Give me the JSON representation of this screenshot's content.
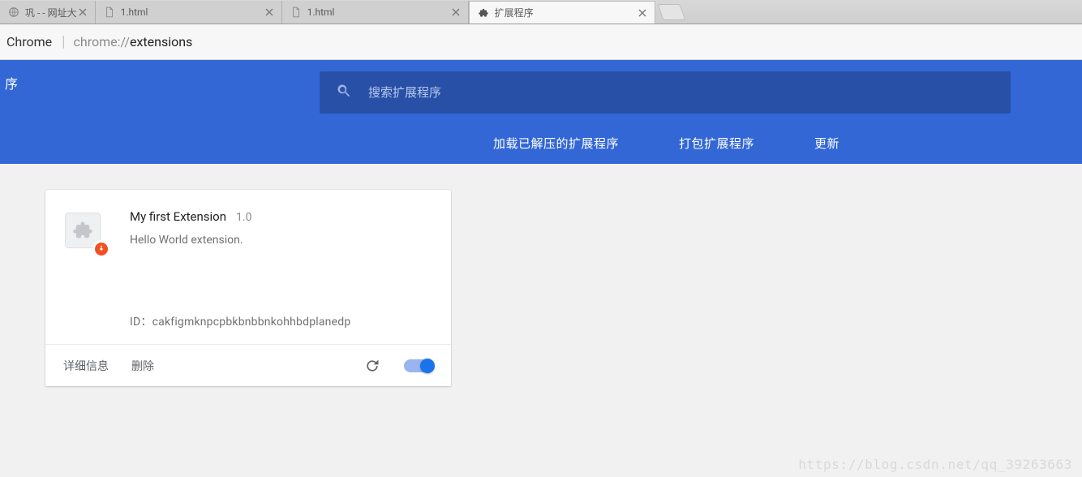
{
  "tabs": [
    {
      "title": "巩 -  - 网址大",
      "active": false,
      "kind": "url"
    },
    {
      "title": "1.html",
      "active": false,
      "kind": "file"
    },
    {
      "title": "1.html",
      "active": false,
      "kind": "file"
    },
    {
      "title": "扩展程序",
      "active": true,
      "kind": "ext"
    }
  ],
  "omnibox": {
    "brand": "Chrome",
    "url_prefix": "chrome://",
    "url_path": "extensions"
  },
  "header": {
    "side_cut": "序",
    "search_placeholder": "搜索扩展程序",
    "actions": {
      "load_unpacked": "加载已解压的扩展程序",
      "pack": "打包扩展程序",
      "update": "更新"
    }
  },
  "extensions": [
    {
      "name": "My first Extension",
      "version": "1.0",
      "description": "Hello World extension.",
      "id_label": "ID：",
      "id": "cakfigmknpcpbkbnbbnkohhbdplanedp",
      "enabled": true
    }
  ],
  "card_actions": {
    "details": "详细信息",
    "remove": "删除"
  },
  "watermark": "https://blog.csdn.net/qq_39263663"
}
